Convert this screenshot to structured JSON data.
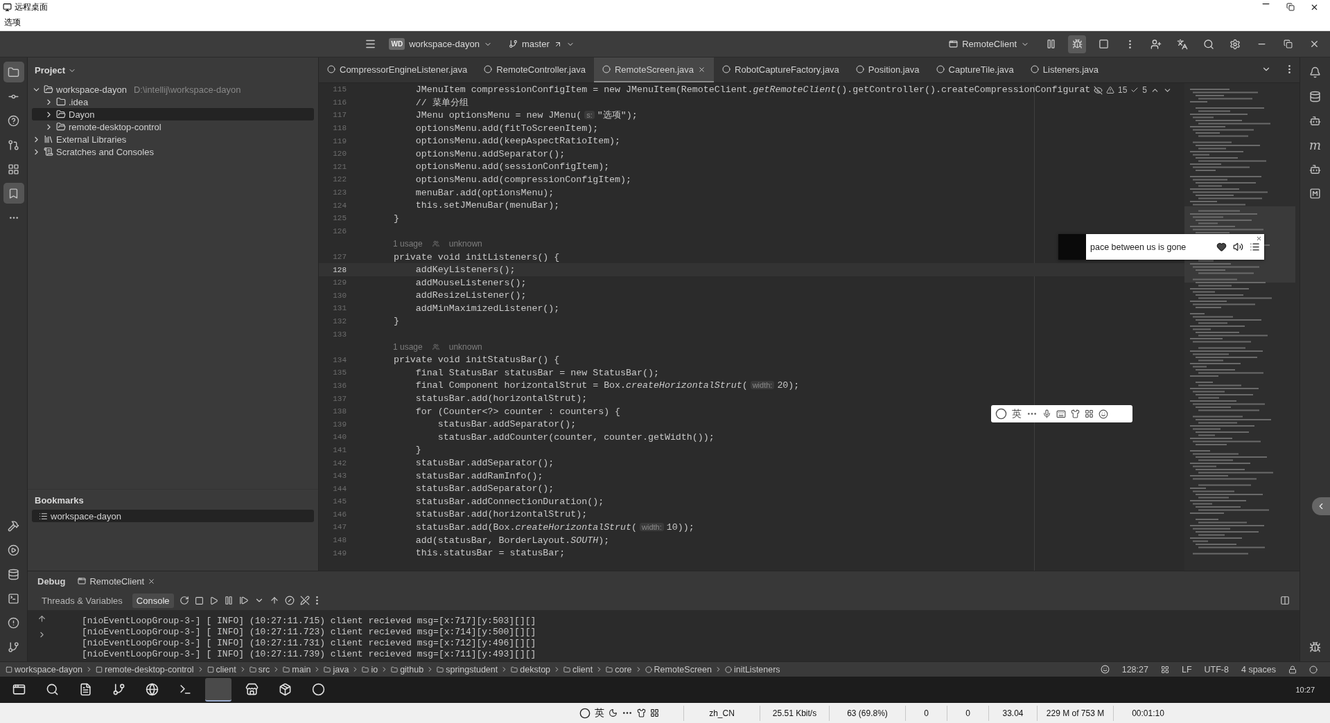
{
  "window": {
    "title": "远程桌面"
  },
  "menu": [
    "选项"
  ],
  "toolbar": {
    "project_badge": "WD",
    "project": "workspace-dayon",
    "branch": "master",
    "run_config": "RemoteClient"
  },
  "left_strip": [
    {
      "kind": "project",
      "selected": true
    },
    {
      "kind": "commit",
      "selected": false
    },
    {
      "kind": "help",
      "selected": false
    },
    {
      "kind": "pull",
      "selected": false
    },
    {
      "kind": "structure",
      "selected": false
    },
    {
      "kind": "bookmarks",
      "selected": true
    },
    {
      "kind": "more",
      "selected": false
    },
    {
      "kind": "build",
      "selected": false
    },
    {
      "kind": "services",
      "selected": false
    },
    {
      "kind": "database",
      "selected": false
    },
    {
      "kind": "terminal",
      "selected": false
    },
    {
      "kind": "problems",
      "selected": false
    },
    {
      "kind": "git",
      "selected": false
    }
  ],
  "project_panel": {
    "title": "Project",
    "tree": [
      {
        "label": "workspace-dayon",
        "path": "D:\\intellij\\workspace-dayon",
        "kind": "module",
        "expanded": true,
        "selected": false,
        "children": [
          {
            "label": ".idea",
            "kind": "folder",
            "expanded": false,
            "selected": false
          },
          {
            "label": "Dayon",
            "kind": "module",
            "expanded": false,
            "selected": true
          },
          {
            "label": "remote-desktop-control",
            "kind": "module",
            "expanded": false,
            "selected": false
          }
        ]
      },
      {
        "label": "External Libraries",
        "kind": "library",
        "expanded": false,
        "selected": false
      },
      {
        "label": "Scratches and Consoles",
        "kind": "scratch",
        "expanded": false,
        "selected": false
      }
    ]
  },
  "bookmarks": {
    "title": "Bookmarks",
    "items": [
      {
        "label": "workspace-dayon",
        "selected": true
      }
    ]
  },
  "tabs": [
    {
      "label": "CompressorEngineListener.java",
      "selected": false
    },
    {
      "label": "RemoteController.java",
      "selected": false
    },
    {
      "label": "RemoteScreen.java",
      "selected": true
    },
    {
      "label": "RobotCaptureFactory.java",
      "selected": false
    },
    {
      "label": "Position.java",
      "selected": false
    },
    {
      "label": "CaptureTile.java",
      "selected": false
    },
    {
      "label": "Listeners.java",
      "selected": false
    }
  ],
  "editor": {
    "warnings": "15",
    "checks": "5",
    "lines": [
      {
        "kind": "code",
        "number": "115",
        "current": false,
        "code": "        JMenuItem compressionConfigItem = new JMenuItem(RemoteClient.*getRemoteClient*().getController().createCompressionConfigurat"
      },
      {
        "kind": "code",
        "number": "116",
        "current": false,
        "code": "        // 菜单分组"
      },
      {
        "kind": "code",
        "number": "117",
        "current": false,
        "code": "        JMenu optionsMenu = new JMenu(",
        "hint": "s:",
        "rest": "\"选项\");"
      },
      {
        "kind": "code",
        "number": "118",
        "current": false,
        "code": "        optionsMenu.add(fitToScreenItem);"
      },
      {
        "kind": "code",
        "number": "119",
        "current": false,
        "code": "        optionsMenu.add(keepAspectRatioItem);"
      },
      {
        "kind": "code",
        "number": "120",
        "current": false,
        "code": "        optionsMenu.addSeparator();"
      },
      {
        "kind": "code",
        "number": "121",
        "current": false,
        "code": "        optionsMenu.add(sessionConfigItem);"
      },
      {
        "kind": "code",
        "number": "122",
        "current": false,
        "code": "        optionsMenu.add(compressionConfigItem);"
      },
      {
        "kind": "code",
        "number": "123",
        "current": false,
        "code": "        menuBar.add(optionsMenu);"
      },
      {
        "kind": "code",
        "number": "124",
        "current": false,
        "code": "        this.setJMenuBar(menuBar);"
      },
      {
        "kind": "code",
        "number": "125",
        "current": false,
        "code": "    }"
      },
      {
        "kind": "code",
        "number": "126",
        "current": false
      },
      {
        "kind": "usage",
        "usage": "1 usage",
        "author": "unknown"
      },
      {
        "kind": "code",
        "number": "127",
        "current": false,
        "code": "    private void initListeners() {"
      },
      {
        "kind": "code",
        "number": "128",
        "current": true,
        "code": "        addKeyListeners();"
      },
      {
        "kind": "code",
        "number": "129",
        "current": false,
        "code": "        addMouseListeners();"
      },
      {
        "kind": "code",
        "number": "130",
        "current": false,
        "code": "        addResizeListener();"
      },
      {
        "kind": "code",
        "number": "131",
        "current": false,
        "code": "        addMinMaximizedListener();"
      },
      {
        "kind": "code",
        "number": "132",
        "current": false,
        "code": "    }"
      },
      {
        "kind": "code",
        "number": "133",
        "current": false
      },
      {
        "kind": "usage",
        "usage": "1 usage",
        "author": "unknown"
      },
      {
        "kind": "code",
        "number": "134",
        "current": false,
        "code": "    private void initStatusBar() {"
      },
      {
        "kind": "code",
        "number": "135",
        "current": false,
        "code": "        final StatusBar statusBar = new StatusBar();"
      },
      {
        "kind": "code",
        "number": "136",
        "current": false,
        "code": "        final Component horizontalStrut = Box.*createHorizontalStrut*(",
        "hint": "width:",
        "rest": "20);"
      },
      {
        "kind": "code",
        "number": "137",
        "current": false,
        "code": "        statusBar.add(horizontalStrut);"
      },
      {
        "kind": "code",
        "number": "138",
        "current": false,
        "code": "        for (Counter<?> counter : counters) {"
      },
      {
        "kind": "code",
        "number": "139",
        "current": false,
        "code": "            statusBar.addSeparator();"
      },
      {
        "kind": "code",
        "number": "140",
        "current": false,
        "code": "            statusBar.addCounter(counter, counter.getWidth());"
      },
      {
        "kind": "code",
        "number": "141",
        "current": false,
        "code": "        }"
      },
      {
        "kind": "code",
        "number": "142",
        "current": false,
        "code": "        statusBar.addSeparator();"
      },
      {
        "kind": "code",
        "number": "143",
        "current": false,
        "code": "        statusBar.addRamInfo();"
      },
      {
        "kind": "code",
        "number": "144",
        "current": false,
        "code": "        statusBar.addSeparator();"
      },
      {
        "kind": "code",
        "number": "145",
        "current": false,
        "code": "        statusBar.addConnectionDuration();"
      },
      {
        "kind": "code",
        "number": "146",
        "current": false,
        "code": "        statusBar.add(horizontalStrut);"
      },
      {
        "kind": "code",
        "number": "147",
        "current": false,
        "code": "        statusBar.add(Box.*createHorizontalStrut*(",
        "hint": "width:",
        "rest": "10));"
      },
      {
        "kind": "code",
        "number": "148",
        "current": false,
        "code": "        add(statusBar, BorderLayout.*SOUTH*);"
      },
      {
        "kind": "code",
        "number": "149",
        "current": false,
        "code": "        this.statusBar = statusBar;"
      }
    ]
  },
  "right_strip": {
    "maven": "m"
  },
  "now_playing": {
    "title": "pace between us is gone"
  },
  "ime_toolbar": {
    "mode": "英"
  },
  "debug": {
    "title": "Debug",
    "session": "RemoteClient",
    "subtabs": [
      {
        "label": "Threads & Variables",
        "selected": false
      },
      {
        "label": "Console",
        "selected": true
      }
    ],
    "console": [
      "[nioEventLoopGroup-3-] [ INFO] (10:27:11.715) client recieved msg=[x:717][y:503][][]",
      "[nioEventLoopGroup-3-] [ INFO] (10:27:11.723) client recieved msg=[x:714][y:500][][]",
      "[nioEventLoopGroup-3-] [ INFO] (10:27:11.731) client recieved msg=[x:712][y:496][][]",
      "[nioEventLoopGroup-3-] [ INFO] (10:27:11.739) client recieved msg=[x:711][y:493][][]"
    ]
  },
  "breadcrumbs": [
    {
      "label": "workspace-dayon",
      "kind": "module"
    },
    {
      "label": "remote-desktop-control",
      "kind": "module"
    },
    {
      "label": "client",
      "kind": "module"
    },
    {
      "label": "src",
      "kind": "folder"
    },
    {
      "label": "main",
      "kind": "folder"
    },
    {
      "label": "java",
      "kind": "folder"
    },
    {
      "label": "io",
      "kind": "folder"
    },
    {
      "label": "github",
      "kind": "folder"
    },
    {
      "label": "springstudent",
      "kind": "folder"
    },
    {
      "label": "dekstop",
      "kind": "folder"
    },
    {
      "label": "client",
      "kind": "folder"
    },
    {
      "label": "core",
      "kind": "folder"
    },
    {
      "label": "RemoteScreen",
      "kind": "class"
    },
    {
      "label": "initListeners",
      "kind": "method"
    }
  ],
  "status": {
    "position": "128:27",
    "line_ending": "LF",
    "encoding": "UTF-8",
    "indent": "4 spaces"
  },
  "taskbar": {
    "clock": "10:27",
    "apps": [
      {
        "kind": "start",
        "selected": false
      },
      {
        "kind": "search",
        "selected": false
      },
      {
        "kind": "writer",
        "selected": false
      },
      {
        "kind": "git",
        "selected": false
      },
      {
        "kind": "globe",
        "selected": false
      },
      {
        "kind": "terminal",
        "selected": false
      },
      {
        "kind": "ide",
        "selected": true
      },
      {
        "kind": "store",
        "selected": false
      },
      {
        "kind": "package",
        "selected": false
      },
      {
        "kind": "browser",
        "selected": false
      }
    ]
  },
  "remote_status": {
    "ime_mode": "英",
    "fields": [
      "zh_CN",
      "25.51 Kbit/s",
      "63 (69.8%)",
      "0",
      "0",
      "33.04",
      "229 M of 753 M",
      "00:01:10"
    ]
  }
}
